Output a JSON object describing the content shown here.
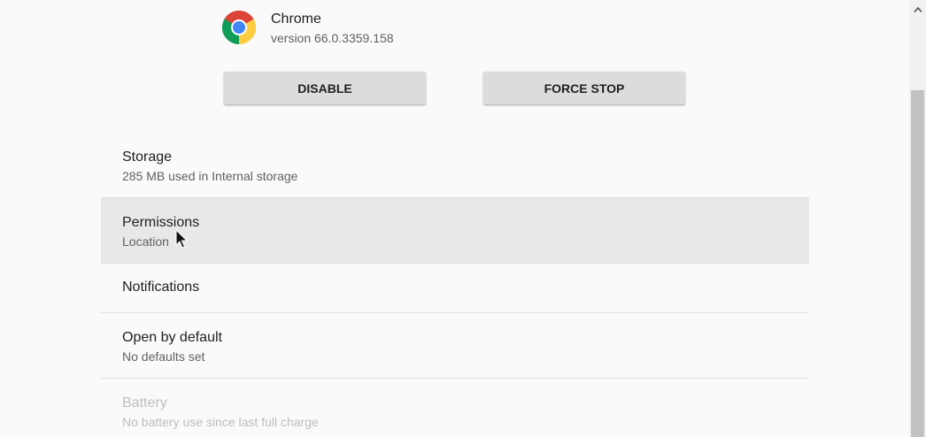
{
  "app": {
    "name": "Chrome",
    "version": "version 66.0.3359.158",
    "icon": "chrome-logo-icon"
  },
  "buttons": {
    "disable_label": "DISABLE",
    "force_stop_label": "FORCE STOP"
  },
  "list": {
    "storage": {
      "title": "Storage",
      "subtitle": "285 MB used in Internal storage"
    },
    "permissions": {
      "title": "Permissions",
      "subtitle": "Location"
    },
    "notifications": {
      "title": "Notifications"
    },
    "open_by_default": {
      "title": "Open by default",
      "subtitle": "No defaults set"
    },
    "battery": {
      "title": "Battery",
      "subtitle": "No battery use since last full charge"
    }
  },
  "colors": {
    "background": "#fafafa",
    "button": "#dcdcdc",
    "highlight_row": "#e8e8e8",
    "divider": "#e0e0e0",
    "disabled_text": "#bdbdbd"
  }
}
